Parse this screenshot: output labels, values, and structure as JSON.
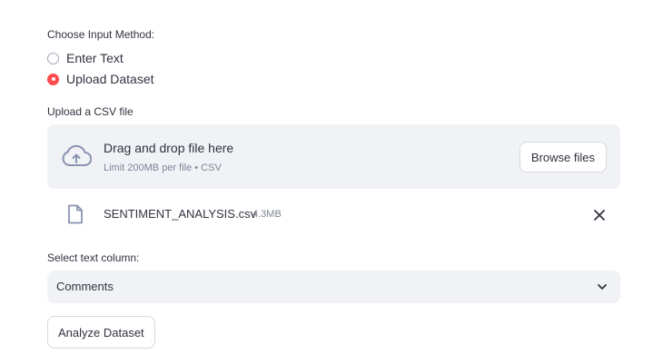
{
  "input_method": {
    "label": "Choose Input Method:",
    "options": [
      {
        "label": "Enter Text",
        "selected": false
      },
      {
        "label": "Upload Dataset",
        "selected": true
      }
    ]
  },
  "uploader": {
    "label": "Upload a CSV file",
    "dropzone_title": "Drag and drop file here",
    "dropzone_limit": "Limit 200MB per file • CSV",
    "browse_label": "Browse files",
    "cloud_icon": "cloud-upload-icon"
  },
  "uploaded_file": {
    "name": "SENTIMENT_ANALYSIS.csv",
    "size": "4.3MB",
    "file_icon": "file-icon",
    "remove_icon": "close-icon"
  },
  "text_column": {
    "label": "Select text column:",
    "value": "Comments",
    "chevron_icon": "chevron-down-icon"
  },
  "analyze_button": {
    "label": "Analyze Dataset"
  },
  "colors": {
    "accent": "#ff4b4b",
    "panel": "#f0f2f6",
    "text": "#31333f",
    "muted": "#808495"
  }
}
